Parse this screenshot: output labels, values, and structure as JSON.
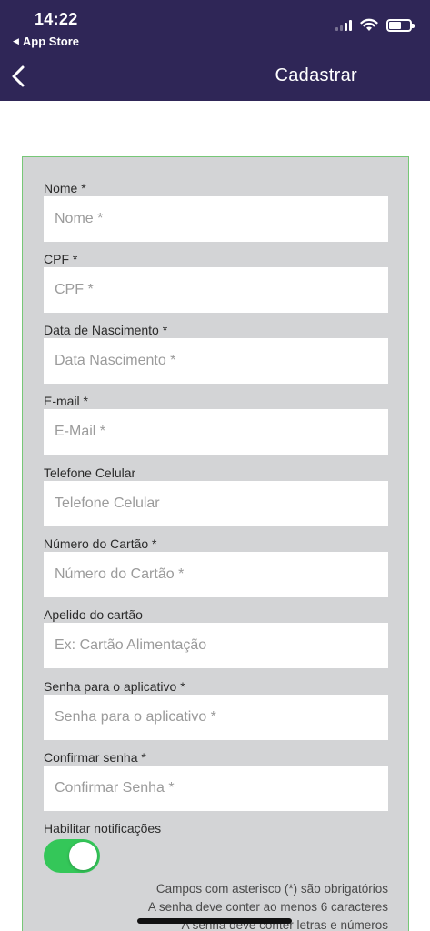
{
  "status_bar": {
    "time": "14:22",
    "back_app": "App Store",
    "back_arrow": "◀"
  },
  "header": {
    "title": "Cadastrar",
    "back_icon": "chevron-left-icon"
  },
  "form": {
    "fields": [
      {
        "label": "Nome *",
        "placeholder": "Nome *"
      },
      {
        "label": "CPF *",
        "placeholder": "CPF *"
      },
      {
        "label": "Data de Nascimento *",
        "placeholder": "Data Nascimento *"
      },
      {
        "label": "E-mail *",
        "placeholder": "E-Mail *"
      },
      {
        "label": "Telefone Celular",
        "placeholder": "Telefone Celular"
      },
      {
        "label": "Número do Cartão *",
        "placeholder": "Número do Cartão *"
      },
      {
        "label": "Apelido do cartão",
        "placeholder": "Ex: Cartão Alimentação"
      },
      {
        "label": "Senha para o aplicativo *",
        "placeholder": "Senha para o aplicativo *"
      },
      {
        "label": "Confirmar senha *",
        "placeholder": "Confirmar Senha *"
      }
    ],
    "notifications": {
      "label": "Habilitar notificações",
      "enabled": true
    },
    "notes": [
      "Campos com asterisco (*) são obrigatórios",
      "A senha deve conter ao menos 6 caracteres",
      "A senha deve conter letras e números"
    ]
  },
  "colors": {
    "header_bg": "#2f2657",
    "form_bg": "#d3d4d6",
    "form_border": "#77c777",
    "toggle_on": "#34c759"
  }
}
